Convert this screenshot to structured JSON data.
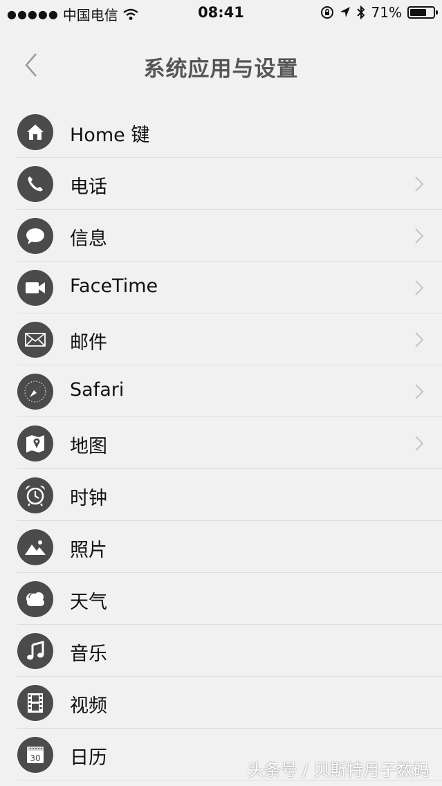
{
  "status_bar": {
    "carrier": "中国电信",
    "time": "08:41",
    "battery_percent": "71%",
    "battery_level": 0.71
  },
  "header": {
    "title": "系统应用与设置"
  },
  "settings_items": [
    {
      "label": "Home 键",
      "icon": "home-icon",
      "has_chevron": false
    },
    {
      "label": "电话",
      "icon": "phone-icon",
      "has_chevron": true
    },
    {
      "label": "信息",
      "icon": "message-icon",
      "has_chevron": true
    },
    {
      "label": "FaceTime",
      "icon": "video-camera-icon",
      "has_chevron": true
    },
    {
      "label": "邮件",
      "icon": "mail-icon",
      "has_chevron": true
    },
    {
      "label": "Safari",
      "icon": "compass-icon",
      "has_chevron": true
    },
    {
      "label": "地图",
      "icon": "map-icon",
      "has_chevron": true
    },
    {
      "label": "时钟",
      "icon": "alarm-clock-icon",
      "has_chevron": false
    },
    {
      "label": "照片",
      "icon": "photo-icon",
      "has_chevron": false
    },
    {
      "label": "天气",
      "icon": "cloud-icon",
      "has_chevron": false
    },
    {
      "label": "音乐",
      "icon": "music-note-icon",
      "has_chevron": false
    },
    {
      "label": "视频",
      "icon": "film-icon",
      "has_chevron": false
    },
    {
      "label": "日历",
      "icon": "calendar-icon",
      "has_chevron": false,
      "icon_text": "30"
    }
  ],
  "watermark": "头条号 / 贝斯特月子数码",
  "colors": {
    "background": "#f1f1f1",
    "icon_circle": "#4b4b4b",
    "title": "#555555",
    "chevron": "#c4c4c4",
    "separator": "#dcdcdc"
  }
}
